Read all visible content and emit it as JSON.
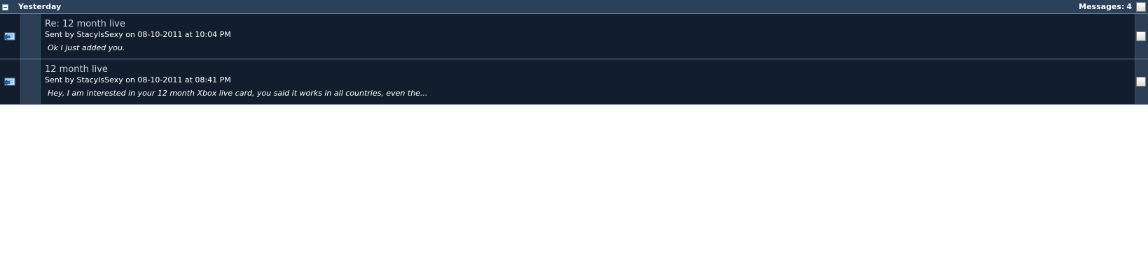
{
  "group": {
    "title": "Yesterday",
    "count_label": "Messages:",
    "count_value": "4"
  },
  "messages": [
    {
      "title": "Re: 12 month live",
      "sent_prefix": "Sent by",
      "sender": "StacyIsSexy",
      "on_label": "on",
      "date": "08-10-2011",
      "at_label": "at",
      "time": "10:04 PM",
      "preview": "Ok I just added you.",
      "icon": "reply-arrow-icon"
    },
    {
      "title": "12 month live",
      "sent_prefix": "Sent by",
      "sender": "StacyIsSexy",
      "on_label": "on",
      "date": "08-10-2011",
      "at_label": "at",
      "time": "08:41 PM",
      "preview": "Hey, I am interested in your 12 month Xbox live card, you said it works in all countries, even the...",
      "icon": "reply-arrow-icon"
    }
  ],
  "colors": {
    "header_bg": "#2b4159",
    "row_bg": "#121e2d",
    "status_col_bg": "#2b3e53",
    "title_text": "#c7d3df",
    "text": "#ffffff"
  }
}
